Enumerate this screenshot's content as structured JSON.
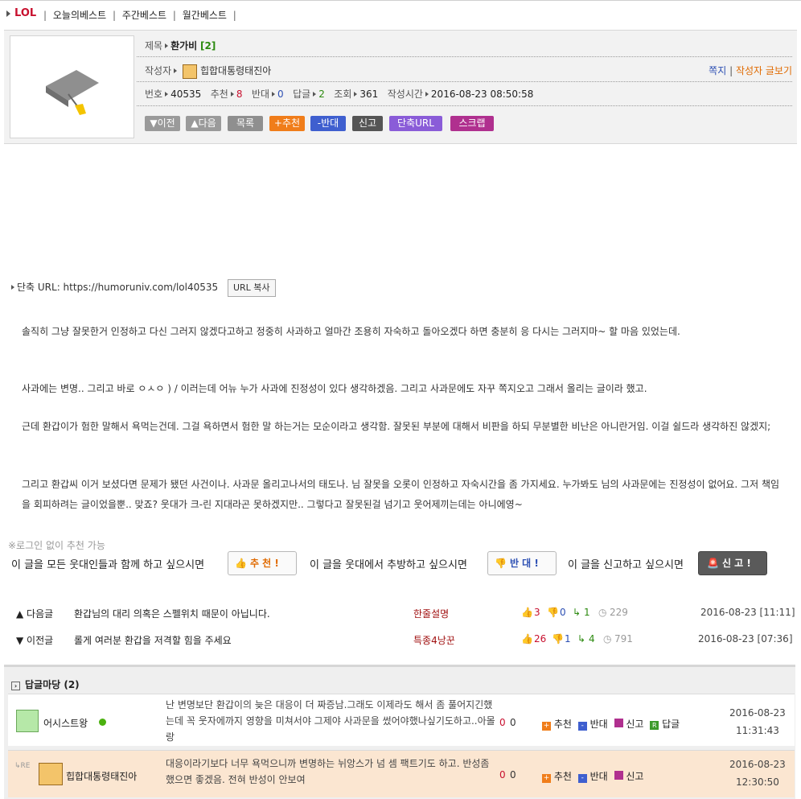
{
  "topbar": {
    "board": "LOL",
    "links": [
      "오늘의베스트",
      "주간베스트",
      "월간베스트"
    ],
    "sep": "|"
  },
  "post": {
    "title_label": "제목",
    "title": "환가비",
    "reply_count": "[2]",
    "author_label": "작성자",
    "author": "힙합대통령태진아",
    "msg_link": "쪽지",
    "author_posts_link": "작성자 글보기",
    "num_label": "번호",
    "num": "40535",
    "rec_label": "추천",
    "rec": "8",
    "opp_label": "반대",
    "opp": "0",
    "reply_label": "답글",
    "reply": "2",
    "view_label": "조회",
    "view": "361",
    "time_label": "작성시간",
    "time": "2016-08-23 08:50:58"
  },
  "buttons": [
    "▼이전",
    "▲다음",
    "목록",
    "+추천",
    "-반대",
    "신고",
    "단축URL",
    "스크랩"
  ],
  "short_url": {
    "label": "단축 URL: https://humoruniv.com/lol40535",
    "copy": "URL 복사"
  },
  "body": [
    "솔직히 그냥 잘못한거 인정하고 다신 그러지 않겠다고하고 정중히 사과하고 얼마간 조용히 자숙하고 돌아오겠다 하면 충분히 응 다시는 그러지마~ 할 마음 있었는데.",
    "사과에는 변명.. 그리고 바로 ㅇㅅㅇ ) / 이러는데 어뉴 누가 사과에 진정성이 있다 생각하겠음. 그리고 사과문에도 자꾸 쪽지오고 그래서 올리는 글이라 했고.",
    "근데 환갑이가 험한 말해서 욕먹는건데. 그걸 욕하면서 험한 말 하는거는 모순이라고 생각함. 잘못된 부분에 대해서 비판을 하되 무분별한 비난은 아니란거임. 이걸 쉴드라 생각하진 않겠지;",
    "그리고 환갑씨 이거 보셨다면 문제가 됐던 사건이나. 사과문 올리고나서의 태도나. 님 잘못을 오롯이 인정하고 자숙시간을 좀 가지세요. 누가봐도 님의 사과문에는 진정성이 없어요. 그저 책임을 회피하려는 글이었을뿐.. 맞죠? 웃대가 크-린 지대라곤 못하겠지만.. 그렇다고 잘못된걸 넘기고 웃어제끼는데는 아니에영~"
  ],
  "vote": {
    "note": "※로그인 없이 추천 가능",
    "rec_text": "이 글을 모든 웃대인들과 함께 하고 싶으시면",
    "rec_btn": "추 천 !",
    "opp_text": "이 글을 웃대에서 추방하고 싶으시면",
    "opp_btn": "반 대 !",
    "report_text": "이 글을 신고하고 싶으시면",
    "report_btn": "신 고 !"
  },
  "nav": [
    {
      "dir": "▲ 다음글",
      "title": "환갑님의 대리 의혹은 스펠위치 때문이 아닙니다.",
      "author": "한줄설명",
      "up": "3",
      "down": "0",
      "reply": "1",
      "views": "229",
      "date": "2016-08-23 [11:11]"
    },
    {
      "dir": "▼ 이전글",
      "title": "롤게 여러분 환갑을 저격할 힘을 주세요",
      "author": "특종4낭꾼",
      "up": "26",
      "down": "1",
      "reply": "4",
      "views": "791",
      "date": "2016-08-23 [07:36]"
    }
  ],
  "replies": {
    "title": "답글마당 (2)",
    "items": [
      {
        "user": "어시스트왕",
        "text": "난 변명보단 환갑이의 늦은 대응이 더 짜증남.그래도 이제라도 해서 좀 풀어지긴했는데 꼭 웃자에까지 영향을 미쳐서야 그제야 사과문을 썼어야했나싶기도하고..아몰랑",
        "score": "0",
        "score2": "0",
        "rec": "추천",
        "opp": "반대",
        "report": "신고",
        "reply": "답글",
        "date": "2016-08-23",
        "time": "11:31:43"
      },
      {
        "user": "힙합대통령태진아",
        "text": "대응이라기보다 너무 욕먹으니까 변명하는 뉘앙스가 넘 셈 팩트기도 하고. 반성좀 했으면 좋겠음. 전혀 반성이 안보여",
        "score": "0",
        "score2": "0",
        "rec": "추천",
        "opp": "반대",
        "report": "신고",
        "date": "2016-08-23",
        "time": "12:30:50"
      }
    ],
    "re_mark": "RE"
  },
  "colors": {
    "red": "#c8102e",
    "blue": "#2c4fb3",
    "green": "#2c8a0f",
    "orange": "#e06a00"
  }
}
